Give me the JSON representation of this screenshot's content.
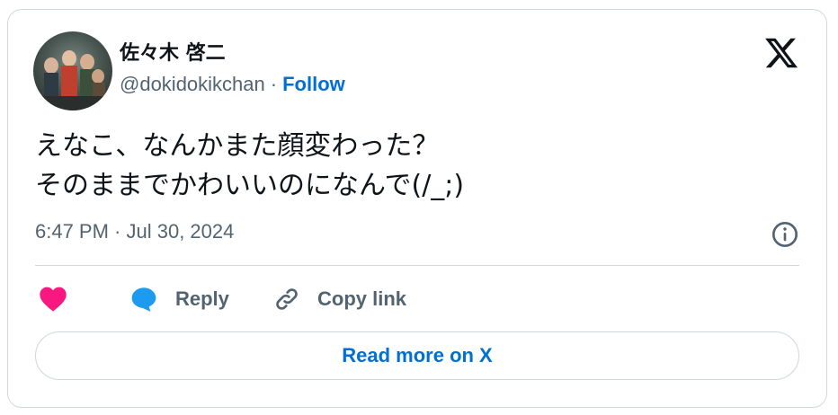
{
  "tweet": {
    "author": {
      "display_name": "佐々木 啓二",
      "handle": "@dokidokikchan",
      "follow_label": "Follow"
    },
    "text_lines": [
      "えなこ、なんかまた顔変わった？",
      "そのままでかわいいのになんで(/_;)"
    ],
    "timestamp": "6:47 PM · Jul 30, 2024"
  },
  "actions": {
    "like_icon": "heart-icon",
    "reply_label": "Reply",
    "copy_link_label": "Copy link"
  },
  "footer": {
    "read_more_label": "Read more on X"
  },
  "colors": {
    "link": "#006fd6",
    "like": "#f91880",
    "reply": "#1d9bf0",
    "muted": "#536471",
    "border": "#cfd9de"
  }
}
